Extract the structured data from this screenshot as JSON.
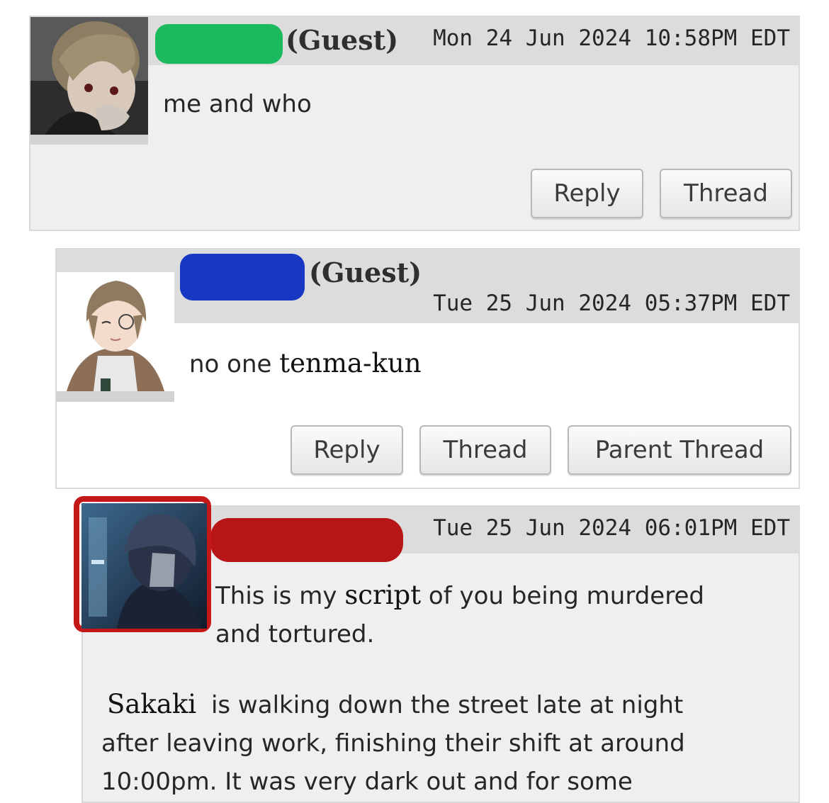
{
  "comments": [
    {
      "author_label": "(Guest)",
      "timestamp": "Mon 24 Jun 2024 10:58PM EDT",
      "body": "me and who",
      "redaction_color": "#1cba5f",
      "buttons": [
        "Reply",
        "Thread"
      ]
    },
    {
      "author_label": "(Guest)",
      "timestamp": "Tue 25 Jun 2024 05:37PM EDT",
      "body_prefix": "no one",
      "body_name": "tenma-kun",
      "redaction_color": "#1638c2",
      "buttons": [
        "Reply",
        "Thread",
        "Parent Thread"
      ]
    },
    {
      "timestamp": "Tue 25 Jun 2024 06:01PM EDT",
      "body_line1_a": "This is my",
      "body_line1_word": "script",
      "body_line1_b": "of you being murdered",
      "body_line2": "and tortured.",
      "para2_name": "Sakaki",
      "para2_line1": "is walking down the street late at night",
      "para2_line2": "after leaving work, finishing their shift at around",
      "para2_line3": "10:00pm. It was very dark out and for some",
      "redaction_color": "#b81616",
      "avatar_outline_color": "#c41818"
    }
  ]
}
